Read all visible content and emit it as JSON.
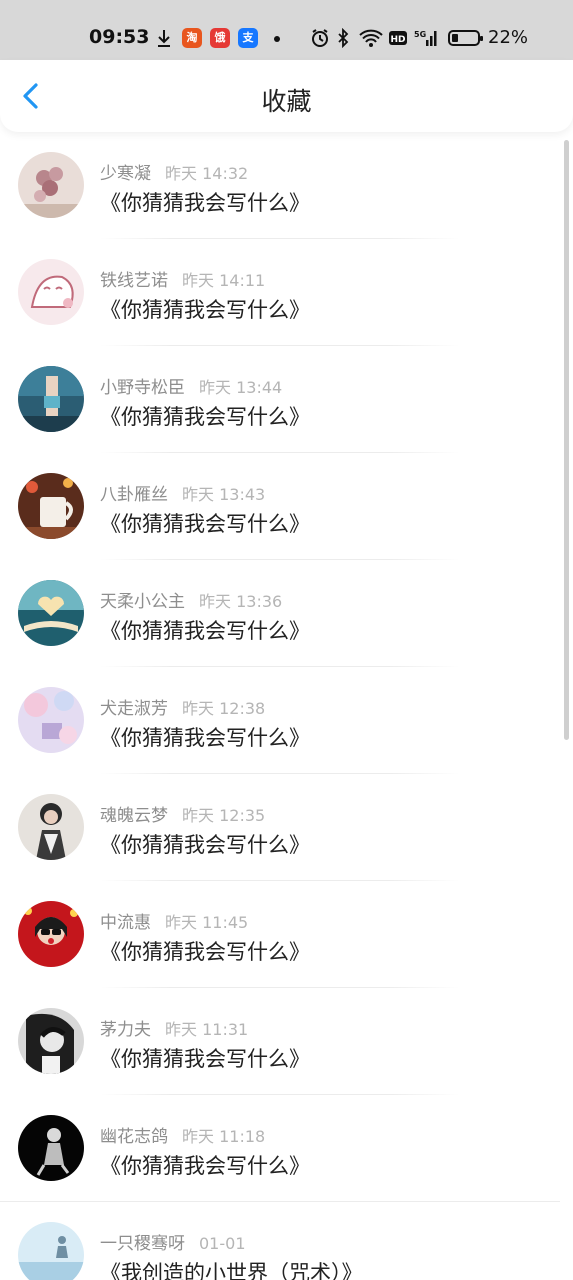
{
  "status_bar": {
    "time": "09:53",
    "battery": "22%",
    "apps": [
      "淘",
      "饿",
      "支"
    ],
    "icons": [
      "download-icon",
      "alarm-icon",
      "bluetooth-icon",
      "wifi-icon",
      "hd-icon",
      "signal-5g-icon",
      "battery-icon"
    ]
  },
  "header": {
    "title": "收藏"
  },
  "favorites": [
    {
      "name": "少寒凝",
      "time": "昨天 14:32",
      "content": "《你猜猜我会写什么》"
    },
    {
      "name": "铁线艺诺",
      "time": "昨天 14:11",
      "content": "《你猜猜我会写什么》"
    },
    {
      "name": "小野寺松臣",
      "time": "昨天 13:44",
      "content": "《你猜猜我会写什么》"
    },
    {
      "name": "八卦雁丝",
      "time": "昨天 13:43",
      "content": "《你猜猜我会写什么》"
    },
    {
      "name": "天柔小公主",
      "time": "昨天 13:36",
      "content": "《你猜猜我会写什么》"
    },
    {
      "name": "犬走淑芳",
      "time": "昨天 12:38",
      "content": "《你猜猜我会写什么》"
    },
    {
      "name": "魂魄云梦",
      "time": "昨天 12:35",
      "content": "《你猜猜我会写什么》"
    },
    {
      "name": "中流惠",
      "time": "昨天 11:45",
      "content": "《你猜猜我会写什么》"
    },
    {
      "name": "茅力夫",
      "time": "昨天 11:31",
      "content": "《你猜猜我会写什么》"
    },
    {
      "name": "幽花志鸽",
      "time": "昨天 11:18",
      "content": "《你猜猜我会写什么》"
    },
    {
      "name": "一只稷骞呀",
      "time": "01-01",
      "content": "《我创造的小世界（咒术）》"
    }
  ],
  "colors": {
    "accent": "#2196f3",
    "status_bar_bg": "#d8d8d8"
  }
}
